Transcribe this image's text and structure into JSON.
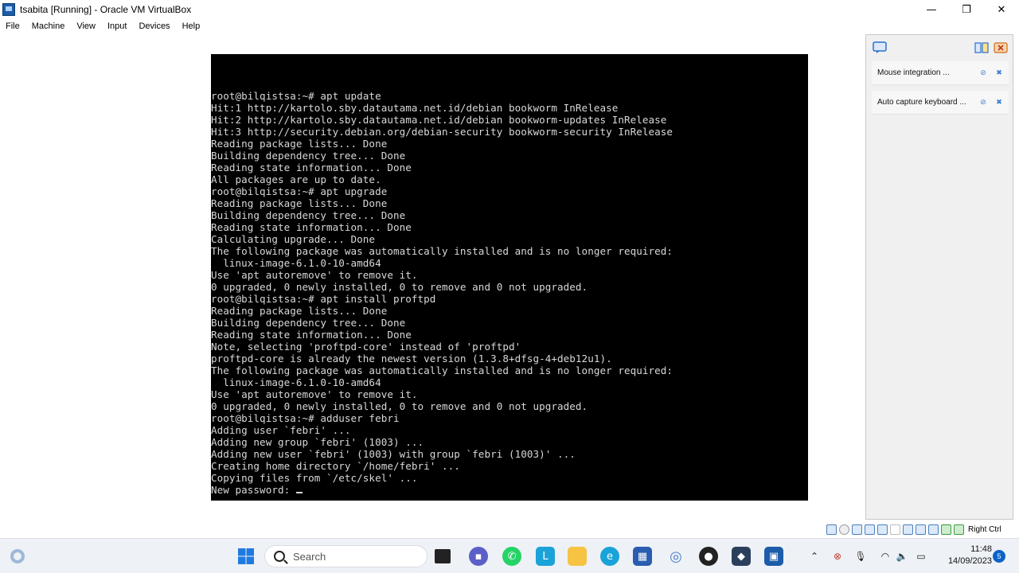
{
  "window": {
    "title": "tsabita [Running] - Oracle VM VirtualBox",
    "minimize_glyph": "—",
    "restore_glyph": "❐",
    "close_glyph": "✕"
  },
  "menu": [
    "File",
    "Machine",
    "View",
    "Input",
    "Devices",
    "Help"
  ],
  "terminal": {
    "lines": [
      "root@bilqistsa:~# apt update",
      "Hit:1 http://kartolo.sby.datautama.net.id/debian bookworm InRelease",
      "Hit:2 http://kartolo.sby.datautama.net.id/debian bookworm-updates InRelease",
      "Hit:3 http://security.debian.org/debian-security bookworm-security InRelease",
      "Reading package lists... Done",
      "Building dependency tree... Done",
      "Reading state information... Done",
      "All packages are up to date.",
      "root@bilqistsa:~# apt upgrade",
      "Reading package lists... Done",
      "Building dependency tree... Done",
      "Reading state information... Done",
      "Calculating upgrade... Done",
      "The following package was automatically installed and is no longer required:",
      "  linux-image-6.1.0-10-amd64",
      "Use 'apt autoremove' to remove it.",
      "0 upgraded, 0 newly installed, 0 to remove and 0 not upgraded.",
      "root@bilqistsa:~# apt install proftpd",
      "Reading package lists... Done",
      "Building dependency tree... Done",
      "Reading state information... Done",
      "Note, selecting 'proftpd-core' instead of 'proftpd'",
      "proftpd-core is already the newest version (1.3.8+dfsg-4+deb12u1).",
      "The following package was automatically installed and is no longer required:",
      "  linux-image-6.1.0-10-amd64",
      "Use 'apt autoremove' to remove it.",
      "0 upgraded, 0 newly installed, 0 to remove and 0 not upgraded.",
      "root@bilqistsa:~# adduser febri",
      "Adding user `febri' ...",
      "Adding new group `febri' (1003) ...",
      "Adding new user `febri' (1003) with group `febri (1003)' ...",
      "Creating home directory `/home/febri' ...",
      "Copying files from `/etc/skel' ...",
      "New password: "
    ]
  },
  "side_panel": {
    "notifications": [
      {
        "text": "Mouse integration ...",
        "snooze_icon": "⊘",
        "close_icon": "✖"
      },
      {
        "text": "Auto capture keyboard ...",
        "snooze_icon": "⊘",
        "close_icon": "✖"
      }
    ]
  },
  "statusbar": {
    "host_key_label": "Right Ctrl"
  },
  "taskbar": {
    "search_placeholder": "Search",
    "time": "11:48",
    "date": "14/09/2023",
    "notification_count": "5",
    "colors": {
      "accent": "#0a63c9",
      "start_blue": "#1f7ae0",
      "whatsapp": "#25d366",
      "teams": "#5b5fc7",
      "edge": "#1aa3d9",
      "explorer": "#f6c343"
    }
  }
}
